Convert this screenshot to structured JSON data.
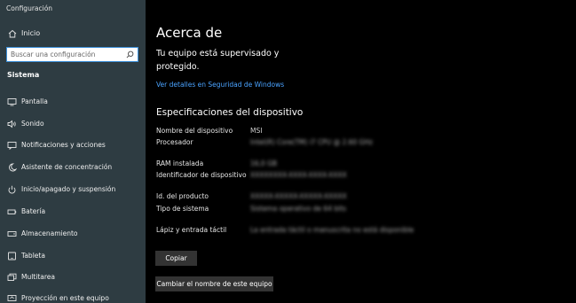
{
  "app": {
    "title": "Configuración"
  },
  "sidebar": {
    "home_label": "Inicio",
    "search_placeholder": "Buscar una configuración",
    "section_title": "Sistema",
    "items": [
      {
        "label": "Pantalla",
        "icon": "display-icon"
      },
      {
        "label": "Sonido",
        "icon": "sound-icon"
      },
      {
        "label": "Notificaciones y acciones",
        "icon": "notifications-icon"
      },
      {
        "label": "Asistente de concentración",
        "icon": "moon-icon"
      },
      {
        "label": "Inicio/apagado y suspensión",
        "icon": "power-icon"
      },
      {
        "label": "Batería",
        "icon": "battery-icon"
      },
      {
        "label": "Almacenamiento",
        "icon": "storage-icon"
      },
      {
        "label": "Tableta",
        "icon": "tablet-icon"
      },
      {
        "label": "Multitarea",
        "icon": "multitask-icon"
      },
      {
        "label": "Proyección en este equipo",
        "icon": "projection-icon"
      }
    ]
  },
  "main": {
    "title": "Acerca de",
    "subtitle": "Tu equipo está supervisado y protegido.",
    "security_link": "Ver detalles en Seguridad de Windows",
    "specs_title": "Especificaciones del dispositivo",
    "specs": [
      {
        "label": "Nombre del dispositivo",
        "value": "MSI"
      },
      {
        "label": "Procesador",
        "value": "Intel(R) Core(TM) i7 CPU @ 2.60 GHz"
      },
      {
        "label": "RAM instalada",
        "value": "16,0 GB"
      },
      {
        "label": "Identificador de dispositivo",
        "value": "XXXXXXXX-XXXX-XXXX-XXXX"
      },
      {
        "label": "Id. del producto",
        "value": "XXXXX-XXXXX-XXXXX-XXXXX"
      },
      {
        "label": "Tipo de sistema",
        "value": "Sistema operativo de 64 bits"
      },
      {
        "label": "Lápiz y entrada táctil",
        "value": "La entrada táctil o manuscrita no está disponible"
      }
    ],
    "copy_button": "Copiar",
    "rename_button": "Cambiar el nombre de este equipo"
  }
}
